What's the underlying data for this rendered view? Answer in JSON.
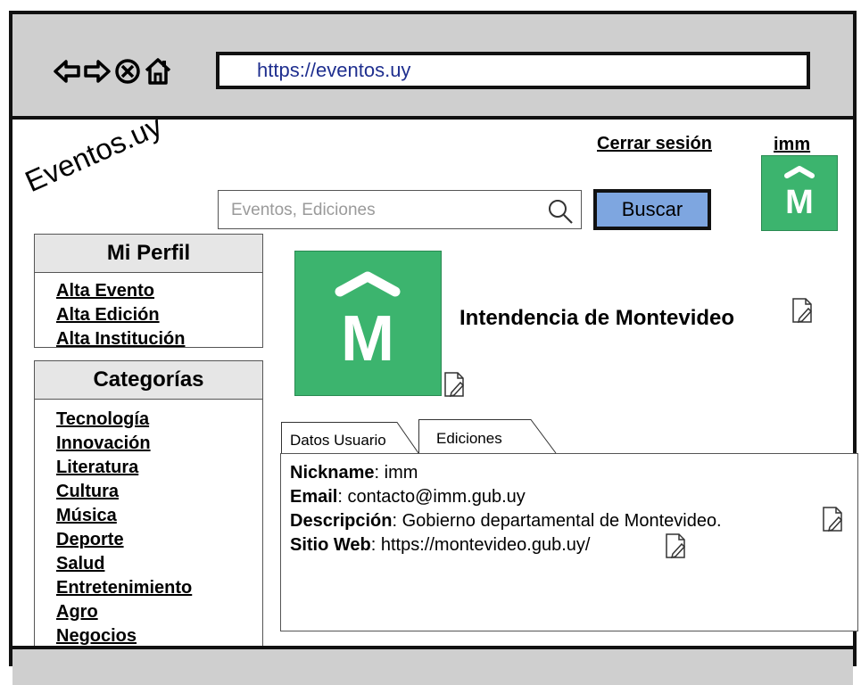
{
  "browser": {
    "icons": [
      "back-arrow-icon",
      "forward-arrow-icon",
      "stop-icon",
      "home-icon"
    ],
    "url": "https://eventos.uy"
  },
  "header": {
    "logo": "Eventos.uy",
    "logout_label": "Cerrar sesión",
    "username": "imm",
    "search_placeholder": "Eventos, Ediciones",
    "search_button": "Buscar"
  },
  "sidebar": {
    "profile_title": "Mi Perfil",
    "profile_links": [
      "Alta Evento",
      "Alta Edición",
      "Alta Institución"
    ],
    "categories_title": "Categorías",
    "categories": [
      "Tecnología",
      "Innovación",
      "Literatura",
      "Cultura",
      "Música",
      "Deporte",
      "Salud",
      "Entretenimiento",
      "Agro",
      "Negocios"
    ]
  },
  "profile": {
    "name": "Intendencia de Montevideo",
    "image_letter": "M",
    "brand_color": "#3cb46e"
  },
  "tabs": [
    {
      "label": "Datos Usuario",
      "active": true
    },
    {
      "label": "Ediciones",
      "active": false
    }
  ],
  "user_data": {
    "nickname_label": "Nickname",
    "nickname": "imm",
    "email_label": "Email",
    "email": "contacto@imm.gub.uy",
    "description_label": "Descripción",
    "description": "Gobierno departamental de Montevideo.",
    "website_label": "Sitio Web",
    "website": "https://montevideo.gub.uy/"
  }
}
